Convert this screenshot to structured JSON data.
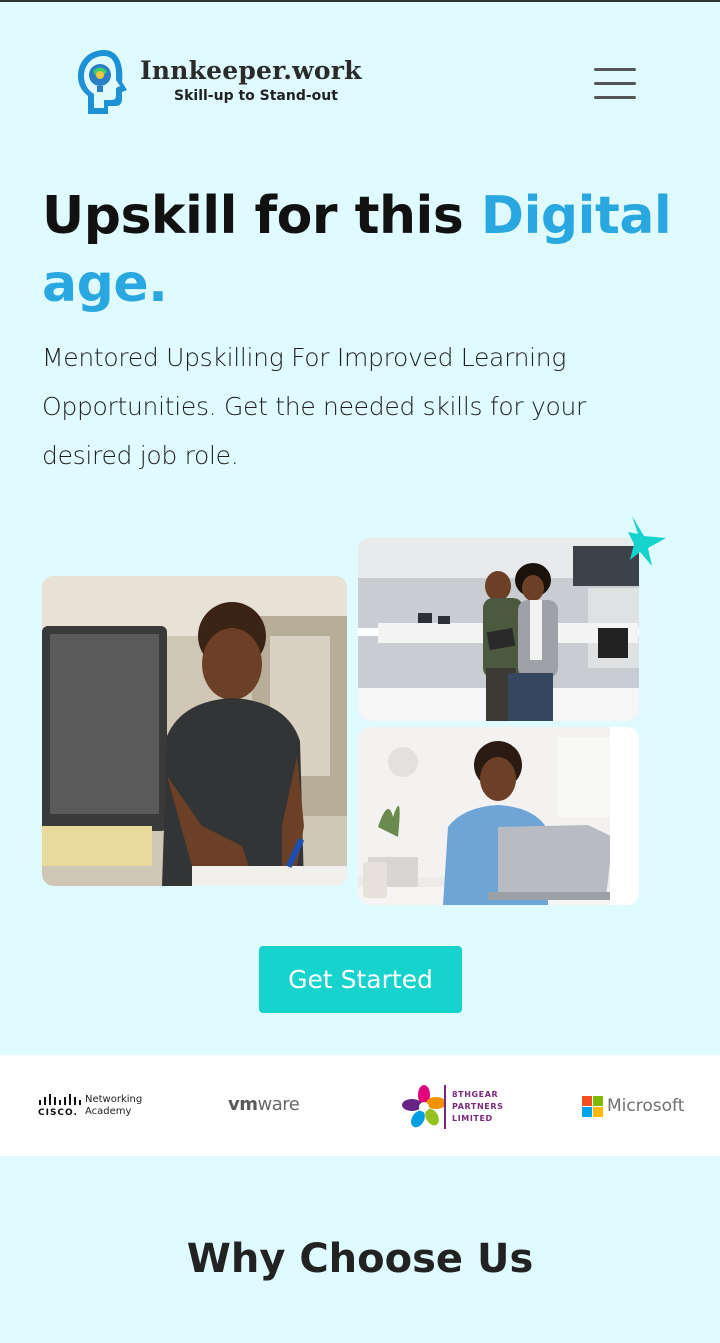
{
  "brand": {
    "name": "Innkeeper.work",
    "tagline": "Skill-up to Stand-out"
  },
  "hero": {
    "title_main": "Upskill for this ",
    "title_accent_1": "Digital",
    "title_accent_2": "age.",
    "subtitle": "Mentored Upskilling For Improved Learning Opportunities. Get the needed skills for your desired job role.",
    "cta_label": "Get Started"
  },
  "partners": {
    "cisco_line1": "Networking",
    "cisco_line2": "Academy",
    "cisco_word": "CISCO.",
    "vmware_vm": "vm",
    "vmware_rest": "ware",
    "gear_line1": "8THGEAR",
    "gear_line2": "PARTNERS",
    "gear_line3": "LIMITED",
    "microsoft": "Microsoft"
  },
  "section": {
    "why_title": "Why Choose Us"
  },
  "colors": {
    "background": "#e0fbff",
    "accent_blue": "#29a7e1",
    "cta_teal": "#16d4cd"
  },
  "icons": [
    "hamburger-menu-icon",
    "star-icon",
    "brain-head-logo-icon"
  ]
}
